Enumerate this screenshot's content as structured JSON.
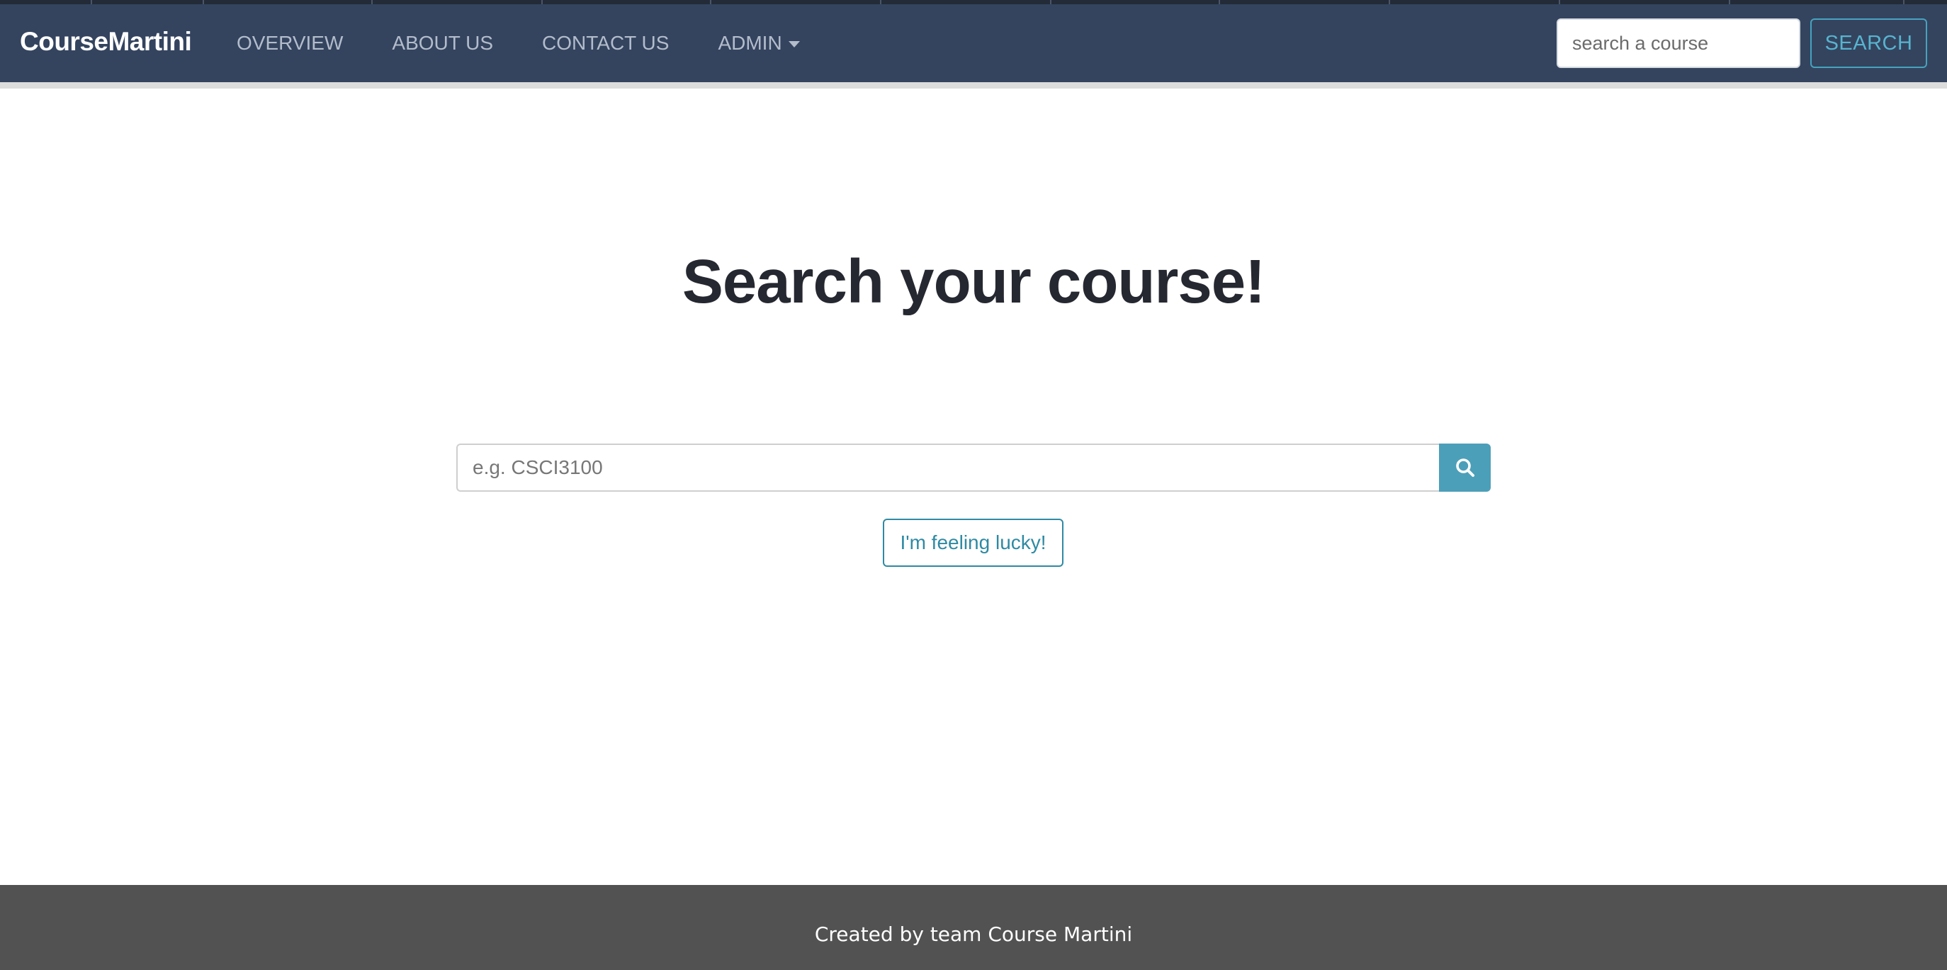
{
  "navbar": {
    "brand": "CourseMartini",
    "links": [
      {
        "label": "OVERVIEW"
      },
      {
        "label": "ABOUT US"
      },
      {
        "label": "CONTACT US"
      },
      {
        "label": "ADMIN",
        "has_dropdown": true
      }
    ],
    "search": {
      "placeholder": "search a course",
      "value": "",
      "button_label": "SEARCH"
    }
  },
  "main": {
    "title": "Search your course!",
    "search": {
      "placeholder": "e.g. CSCI3100",
      "value": "",
      "button_icon": "search-icon"
    },
    "lucky_button_label": "I'm feeling lucky!"
  },
  "footer": {
    "text": "Created by team Course Martini"
  },
  "colors": {
    "navbar_bg": "#34445f",
    "accent": "#4c9fb8",
    "footer_bg": "#525252"
  }
}
